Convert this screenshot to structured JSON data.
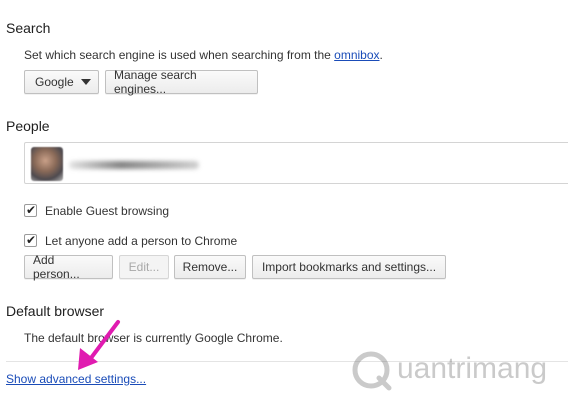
{
  "search": {
    "title": "Search",
    "description": "Set which search engine is used when searching from the ",
    "omnibox_link": "omnibox",
    "description_end": ".",
    "engine_selected": "Google",
    "manage_button": "Manage search engines..."
  },
  "people": {
    "title": "People",
    "guest_label": "Enable Guest browsing",
    "guest_checked": true,
    "anyone_label": "Let anyone add a person to Chrome",
    "anyone_checked": true,
    "add_button": "Add person...",
    "edit_button": "Edit...",
    "remove_button": "Remove...",
    "import_button": "Import bookmarks and settings..."
  },
  "default_browser": {
    "title": "Default browser",
    "status": "The default browser is currently Google Chrome."
  },
  "footer": {
    "advanced_link": "Show advanced settings..."
  },
  "watermark": {
    "text": "uantrimang"
  },
  "colors": {
    "link": "#1a4cb8",
    "arrow": "#e01bb0"
  }
}
